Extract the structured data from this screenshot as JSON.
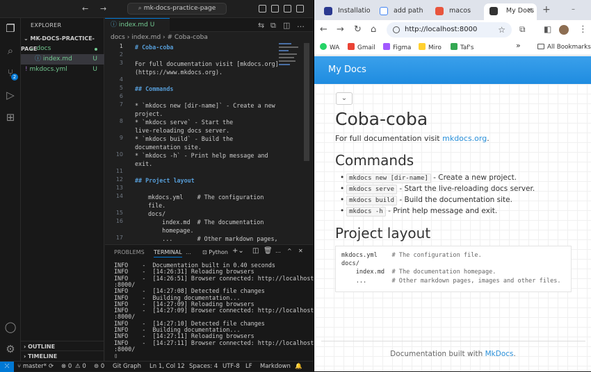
{
  "vscode": {
    "search_label": "mk-docs-practice-page",
    "explorer_title": "EXPLORER",
    "workspace": "MK-DOCS-PRACTICE-PAGE",
    "tree": [
      {
        "label": "docs",
        "icon": "chevron-down-icon"
      },
      {
        "label": "index.md",
        "badge": "U"
      },
      {
        "label": "mkdocs.yml",
        "badge": "U"
      }
    ],
    "outline": "OUTLINE",
    "timeline": "TIMELINE",
    "scm_badge": "2",
    "tab": {
      "label": "index.md",
      "badge": "U"
    },
    "breadcrumb": {
      "folder": "docs",
      "file": "index.md",
      "symbol": "# Coba-coba"
    },
    "line_numbers": [
      "1",
      "2",
      "3",
      "4",
      "5",
      "6",
      "7",
      "8",
      "9",
      "10",
      "11",
      "12",
      "13",
      "14",
      "15",
      "16",
      "17"
    ],
    "code": {
      "l1": "# Coba-coba",
      "l3a": "For full documentation visit [mkdocs.org]",
      "l3b": "(https://www.mkdocs.org).",
      "l5": "## Commands",
      "l7a": "* `mkdocs new [dir-name]` - Create a new",
      "l7b": "project.",
      "l8a": "* `mkdocs serve` - Start the",
      "l8b": "live-reloading docs server.",
      "l9a": "* `mkdocs build` - Build the",
      "l9b": "documentation site.",
      "l10a": "* `mkdocs -h` - Print help message and",
      "l10b": "exit.",
      "l12": "## Project layout",
      "l14a": "mkdocs.yml    # The configuration",
      "l14b": "file.",
      "l15": "docs/",
      "l16a": "    index.md  # The documentation",
      "l16b": "    homepage.",
      "l17": "    ...       # Other markdown pages,"
    },
    "panel_tabs": {
      "problems": "PROBLEMS",
      "terminal": "TERMINAL",
      "shell": "Python"
    },
    "terminal_lines": [
      "INFO    -  Documentation built in 0.40 seconds",
      "INFO    -  [14:26:31] Reloading browsers",
      "INFO    -  [14:26:51] Browser connected: http://localhost",
      ":8000/",
      "INFO    -  [14:27:08] Detected file changes",
      "INFO    -  Building documentation...",
      "INFO    -  [14:27:09] Reloading browsers",
      "INFO    -  [14:27:09] Browser connected: http://localhost",
      ":8000/",
      "INFO    -  [14:27:10] Detected file changes",
      "INFO    -  Building documentation...",
      "INFO    -  [14:27:11] Reloading browsers",
      "INFO    -  [14:27:11] Browser connected: http://localhost",
      ":8000/",
      "▯"
    ],
    "status": {
      "branch": "master*",
      "sync": "⟳",
      "errors": "⊗ 0",
      "warnings": "⚠ 0",
      "ports": "⊚ 0",
      "graph": "Git Graph",
      "position": "Ln 1, Col 12",
      "spaces": "Spaces: 4",
      "encoding": "UTF-8",
      "eol": "LF",
      "language": "Markdown"
    }
  },
  "browser": {
    "tabs": [
      {
        "label": "Installatio",
        "color": "#2b3990"
      },
      {
        "label": "add path",
        "color": "#4285f4"
      },
      {
        "label": "macos",
        "color": "#e8553d"
      },
      {
        "label": "My Docs",
        "color": "#333333"
      }
    ],
    "url": "http://localhost:8000",
    "bookmarks": [
      {
        "label": "WA",
        "color": "#25d366"
      },
      {
        "label": "Gmail",
        "color": "#ea4335"
      },
      {
        "label": "Figma",
        "color": "#a259ff"
      },
      {
        "label": "Miro",
        "color": "#ffd02f"
      },
      {
        "label": "Taf's",
        "color": "#34a853"
      }
    ],
    "more": "»",
    "all_bookmarks": "All Bookmarks",
    "site_name": "My Docs",
    "page": {
      "title": "Coba-coba",
      "intro": "For full documentation visit ",
      "intro_link": "mkdocs.org",
      "intro_end": ".",
      "commands_heading": "Commands",
      "commands": [
        {
          "cmd": "mkdocs new [dir-name]",
          "desc": " - Create a new project."
        },
        {
          "cmd": "mkdocs serve",
          "desc": " - Start the live-reloading docs server."
        },
        {
          "cmd": "mkdocs build",
          "desc": " - Build the documentation site."
        },
        {
          "cmd": "mkdocs -h",
          "desc": " - Print help message and exit."
        }
      ],
      "layout_heading": "Project layout",
      "layout_lines": [
        {
          "code": "mkdocs.yml    ",
          "comment": "# The configuration file."
        },
        {
          "code": "docs/",
          "comment": ""
        },
        {
          "code": "    index.md  ",
          "comment": "# The documentation homepage."
        },
        {
          "code": "    ...       ",
          "comment": "# Other markdown pages, images and other files."
        }
      ],
      "footer_text": "Documentation built with ",
      "footer_link": "MkDocs",
      "footer_end": "."
    }
  }
}
